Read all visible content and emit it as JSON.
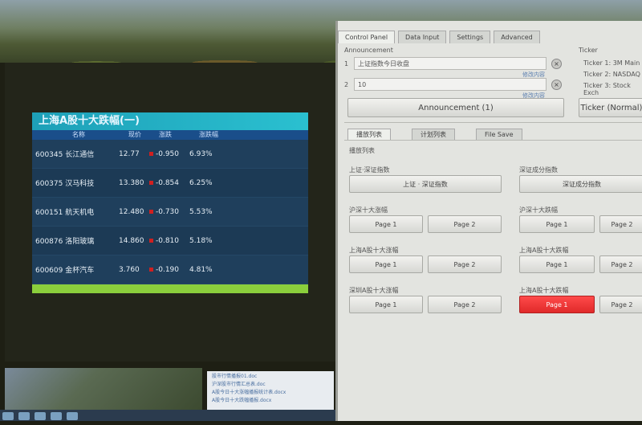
{
  "scoreboard": {
    "title": "上海A股十大跌幅(一)",
    "headers": [
      "名称",
      "现价",
      "涨跌",
      "涨跌幅"
    ],
    "rows": [
      {
        "name": "600345 长江通信",
        "price": "12.77",
        "change": "-0.950",
        "pct": "6.93%"
      },
      {
        "name": "600375 汉马科技",
        "price": "13.380",
        "change": "-0.854",
        "pct": "6.25%"
      },
      {
        "name": "600151 航天机电",
        "price": "12.480",
        "change": "-0.730",
        "pct": "5.53%"
      },
      {
        "name": "600876 洛阳玻璃",
        "price": "14.860",
        "change": "-0.810",
        "pct": "5.18%"
      },
      {
        "name": "600609 金杯汽车",
        "price": "3.760",
        "change": "-0.190",
        "pct": "4.81%"
      }
    ]
  },
  "docs": {
    "items": [
      "股市行情播报01.doc",
      "沪深股市行情汇总表.doc",
      "A股今日十大涨幅播报统计表.docx",
      "A股今日十大跌幅播报.docx"
    ]
  },
  "panel": {
    "tabs": [
      "Control Panel",
      "Data Input",
      "Settings",
      "Advanced"
    ],
    "announcement_label": "Announcement",
    "field1_prefix": "1",
    "field1_value": "上证指数今日收盘",
    "field1_link": "修改内容",
    "field2_prefix": "2",
    "field2_value": "10",
    "field2_link": "修改内容",
    "announcement_btn": "Announcement (1)",
    "ticker_label": "Ticker",
    "ticker_items": [
      "Ticker 1: 3M Main",
      "Ticker 2: NASDAQ",
      "Ticker 3: Stock Exch"
    ],
    "ticker_btn": "Ticker (Normal)",
    "inner_tabs": [
      "播放列表",
      "计划列表",
      "File Save"
    ],
    "list_label": "播放列表",
    "sections": [
      {
        "label": "上证·深证指数",
        "buttons": [
          "上证 · 深证指数"
        ]
      },
      {
        "label": "深证成分指数",
        "buttons": [
          "深证成分指数"
        ]
      },
      {
        "label": "沪深十大涨幅",
        "buttons": [
          "Page 1",
          "Page 2"
        ]
      },
      {
        "label": "沪深十大跌幅",
        "buttons": [
          "Page 1",
          "Page 2"
        ]
      },
      {
        "label": "上海A股十大涨幅",
        "buttons": [
          "Page 1",
          "Page 2"
        ]
      },
      {
        "label": "上海A股十大跌幅",
        "buttons": [
          "Page 1",
          "Page 2"
        ]
      },
      {
        "label": "深圳A股十大涨幅",
        "buttons": [
          "Page 1",
          "Page 2"
        ]
      },
      {
        "label": "上海A股十大跌幅",
        "buttons": [
          "Page 1",
          "Page 2"
        ]
      }
    ]
  },
  "colors": {
    "active_red": "#e02a2a",
    "board_title": "#1ea0b8",
    "board_foot": "#8bcf3c"
  }
}
